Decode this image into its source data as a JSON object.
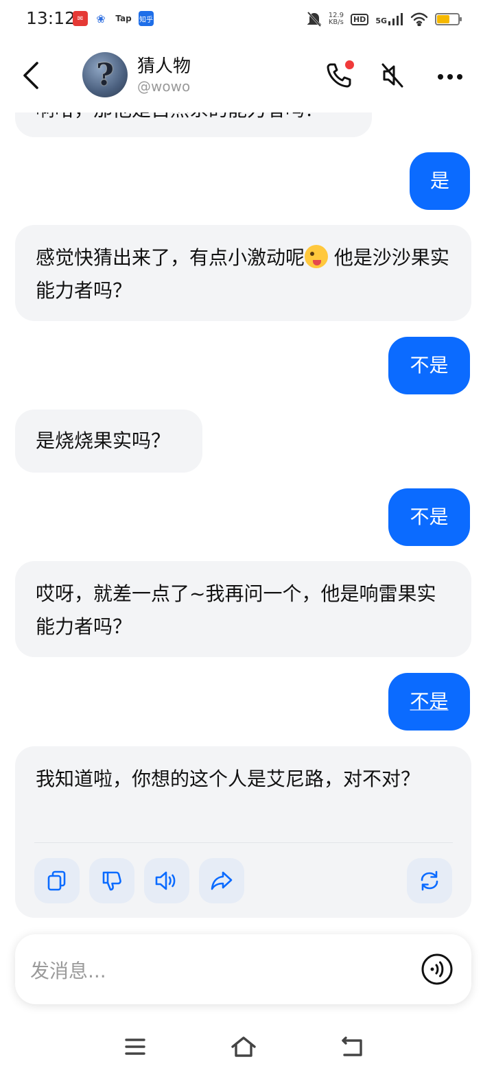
{
  "status_bar": {
    "time": "13:12",
    "net_speed_value": "12.9",
    "net_speed_unit": "KB/s",
    "hd": "HD",
    "network": "5G",
    "app_icons": [
      "red-app-icon",
      "baidu-icon",
      "tap-icon",
      "zhihu-icon"
    ],
    "tap_label": "Tap",
    "zhihu_label": "知乎"
  },
  "header": {
    "title": "猜人物",
    "handle": "@wowo"
  },
  "messages": [
    {
      "role": "bot",
      "text": "啊哈，那他是自然系的能力者吗？"
    },
    {
      "role": "user",
      "text": "是"
    },
    {
      "role": "bot",
      "text_before": "感觉快猜出来了，有点小激动呢",
      "emoji": "winking-face-with-tongue",
      "text_after": " 他是沙沙果实能力者吗？"
    },
    {
      "role": "user",
      "text": "不是"
    },
    {
      "role": "bot",
      "text": "是烧烧果实吗？"
    },
    {
      "role": "user",
      "text": "不是"
    },
    {
      "role": "bot",
      "text": "哎呀，就差一点了~我再问一个，他是响雷果实能力者吗？"
    },
    {
      "role": "user",
      "text": "不是"
    },
    {
      "role": "bot",
      "text": "我知道啦，你想的这个人是艾尼路，对不对？"
    }
  ],
  "actions": [
    "copy-icon",
    "thumbs-down-icon",
    "speaker-icon",
    "share-icon",
    "regenerate-icon"
  ],
  "input": {
    "placeholder": "发消息..."
  },
  "colors": {
    "accent": "#0b6bff",
    "bot_bubble": "#f3f4f6",
    "action_bg": "#e6ecf6",
    "notification_dot": "#f03a3a"
  }
}
